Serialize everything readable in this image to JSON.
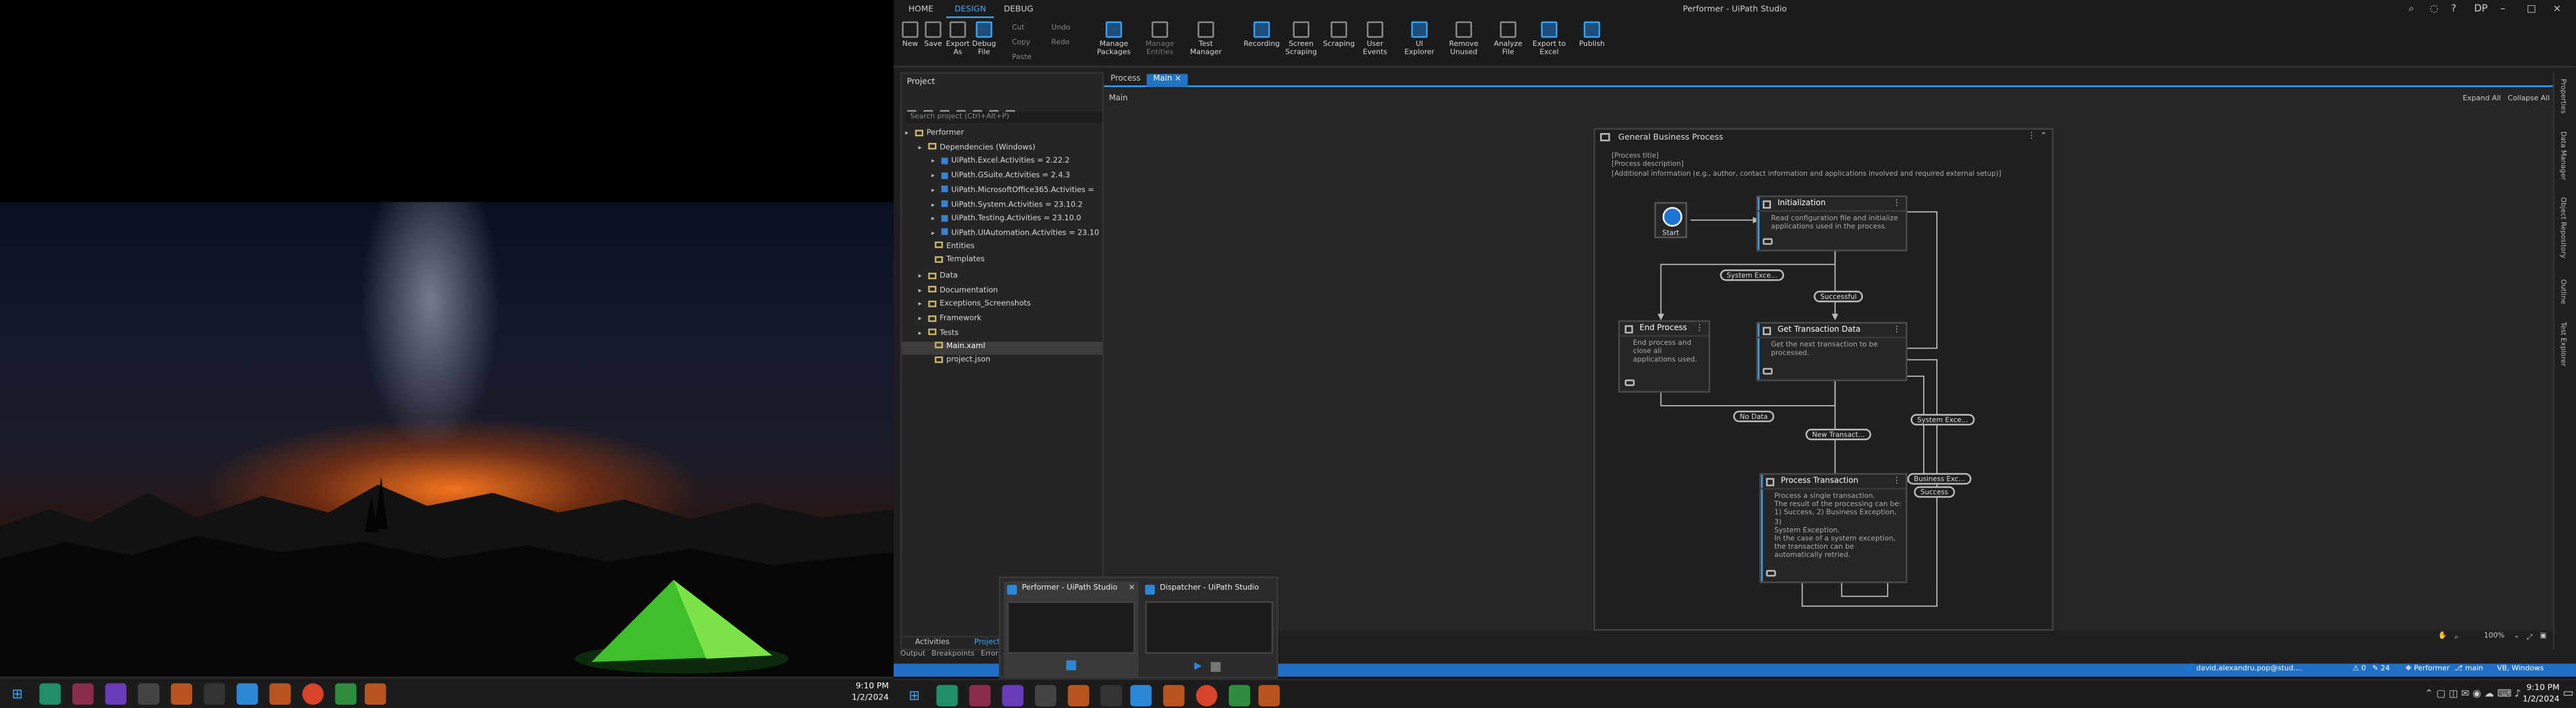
{
  "colors": {
    "accent": "#3da8f5",
    "status_bar": "#1e6fc7",
    "start_node": "#1c74d0"
  },
  "left_taskbar": {
    "clock_time": "9:10 PM",
    "clock_date": "1/2/2024",
    "icons": [
      "windows-start-icon",
      "edge-icon",
      "app-icon",
      "visual-studio-icon",
      "app-icon",
      "app-icon",
      "terminal-icon",
      "uipath-icon",
      "app-icon",
      "chrome-icon",
      "app-icon",
      "app-icon"
    ]
  },
  "ribbon_tabs": [
    "HOME",
    "DESIGN",
    "DEBUG"
  ],
  "window_title": "Performer - UiPath Studio",
  "user_initials": "DP",
  "ribbon": {
    "new": "New",
    "save": "Save",
    "export_as": "Export As",
    "debug_file": "Debug File",
    "cut": "Cut",
    "copy": "Copy",
    "paste": "Paste",
    "undo": "Undo",
    "redo": "Redo",
    "manage_packages": "Manage Packages",
    "manage_entities": "Manage Entities",
    "test_manager": "Test Manager",
    "recording": "Recording",
    "screen_scraping": "Screen Scraping",
    "data_scraping": "Scraping",
    "user_events": "User Events",
    "ui_explorer": "UI Explorer",
    "remove_unused": "Remove Unused",
    "analyze_file": "Analyze File",
    "export_to_excel": "Export to Excel",
    "publish": "Publish"
  },
  "project_panel": {
    "header": "Project",
    "search_placeholder": "Search project (Ctrl+Alt+P)",
    "tree": [
      {
        "label": "Performer",
        "kind": "project"
      },
      {
        "label": "Dependencies (Windows)",
        "kind": "folder"
      },
      {
        "label": "UiPath.Excel.Activities = 2.22.2",
        "kind": "package"
      },
      {
        "label": "UiPath.GSuite.Activities = 2.4.3",
        "kind": "package"
      },
      {
        "label": "UiPath.MicrosoftOffice365.Activities =",
        "kind": "package"
      },
      {
        "label": "UiPath.System.Activities = 23.10.2",
        "kind": "package"
      },
      {
        "label": "UiPath.Testing.Activities = 23.10.0",
        "kind": "package"
      },
      {
        "label": "UiPath.UIAutomation.Activities = 23.10",
        "kind": "package"
      },
      {
        "label": "Entities",
        "kind": "item"
      },
      {
        "label": "Templates",
        "kind": "item"
      },
      {
        "label": "Data",
        "kind": "folder"
      },
      {
        "label": "Documentation",
        "kind": "folder"
      },
      {
        "label": "Exceptions_Screenshots",
        "kind": "folder"
      },
      {
        "label": "Framework",
        "kind": "folder"
      },
      {
        "label": "Tests",
        "kind": "folder"
      },
      {
        "label": "Main.xaml",
        "kind": "file-selected"
      },
      {
        "label": "project.json",
        "kind": "file"
      }
    ],
    "bottom_tabs": [
      "Activities",
      "Project"
    ]
  },
  "output_tabs": [
    "Output",
    "Breakpoints",
    "Errors"
  ],
  "doc_tabs": [
    "Process",
    "Main"
  ],
  "designer": {
    "breadcrumb": "Main",
    "expand_all": "Expand All",
    "collapse_all": "Collapse All",
    "flow_title": "General Business Process",
    "annotation_lines": [
      "[Process title]",
      "[Process description]",
      "[Additional information (e.g., author, contact information and applications involved and required external setup)]"
    ],
    "start_label": "Start",
    "states": {
      "init": {
        "title": "Initialization",
        "body": [
          "Read configuration file and initialize",
          "applications used in the process."
        ]
      },
      "end": {
        "title": "End Process",
        "body": [
          "End process and",
          "close all",
          "applications used."
        ]
      },
      "get": {
        "title": "Get Transaction Data",
        "body": [
          "Get the next transaction to be",
          "processed."
        ]
      },
      "process": {
        "title": "Process Transaction",
        "body": [
          "Process a single transaction.",
          "The result of the processing can be:",
          "1) Success, 2) Business Exception, 3)",
          "System Exception.",
          "In the case of a system exception,",
          "the transaction can be",
          "automatically retried."
        ]
      }
    },
    "transitions": {
      "system_exception_1": "System Exce...",
      "successful": "Successful",
      "no_data": "No Data",
      "new_transaction": "New Transact...",
      "system_exception_2": "System Exce...",
      "business_exception": "Business Exc...",
      "success": "Success"
    },
    "zoom": "100%"
  },
  "right_strip": [
    "Properties",
    "Data Manager",
    "Object Repository",
    "Outline",
    "Test Explorer"
  ],
  "status_bar": {
    "user": "david.alexandru.pop@stud....",
    "errors": "0",
    "warnings": "24",
    "project": "Performer",
    "branch": "main",
    "runtime": "VB, Windows"
  },
  "thumbnails": [
    {
      "title": "Performer - UiPath Studio"
    },
    {
      "title": "Dispatcher - UiPath Studio"
    }
  ],
  "right_taskbar": {
    "clock_time": "9:10 PM",
    "clock_date": "1/2/2024"
  }
}
